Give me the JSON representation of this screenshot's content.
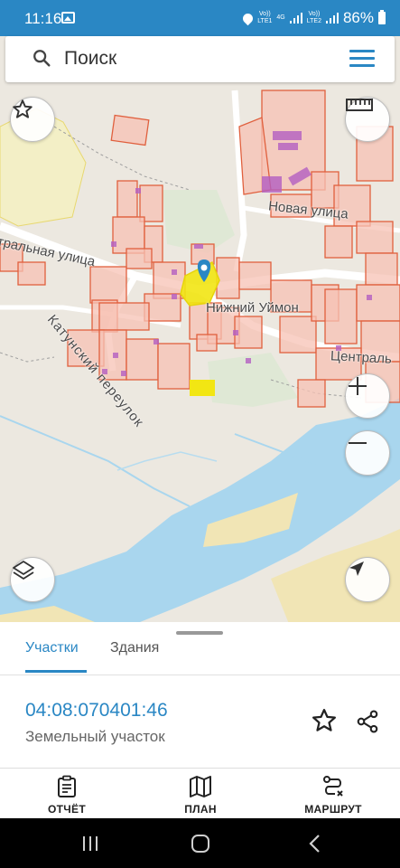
{
  "status_bar": {
    "time": "11:16",
    "network_top": "Vo))",
    "network_label_1": "LTE1",
    "network_4g": "4G",
    "network_label_2": "LTE2",
    "battery": "86%"
  },
  "search": {
    "placeholder": "Поиск",
    "icon": "search-icon",
    "menu_icon": "hamburger-menu-icon"
  },
  "map": {
    "labels": {
      "street_central_left": "тральная улица",
      "street_novaya": "Новая улица",
      "street_katun": "Катунский переулок",
      "village": "Нижний Уймон",
      "street_central_right": "Централь"
    },
    "buttons": {
      "favorite": "star-icon",
      "ruler": "ruler-icon",
      "zoom_in": "plus-icon",
      "zoom_out": "minus-icon",
      "layers": "layers-icon",
      "locate": "navigation-arrow-icon"
    },
    "colors": {
      "background": "#ece8e0",
      "parcel_fill": "#f7c2b4",
      "parcel_stroke": "#e0603e",
      "building": "#b35ec2",
      "highlight": "#f2e613",
      "river": "#a9d6ee",
      "sand": "#f1e5b5",
      "pin": "#2a87c4"
    }
  },
  "sheet": {
    "tabs": [
      {
        "label": "Участки",
        "active": true
      },
      {
        "label": "Здания",
        "active": false
      }
    ],
    "parcel_id": "04:08:070401:46",
    "parcel_type": "Земельный участок",
    "fav_icon": "star-outline-icon",
    "share_icon": "share-icon"
  },
  "bottom_nav": {
    "items": [
      {
        "label": "ОТЧЁТ",
        "icon": "clipboard-icon"
      },
      {
        "label": "ПЛАН",
        "icon": "map-icon"
      },
      {
        "label": "МАРШРУТ",
        "icon": "route-icon"
      }
    ]
  },
  "android_nav": {
    "recents": "recents-icon",
    "home": "home-icon",
    "back": "back-icon"
  }
}
